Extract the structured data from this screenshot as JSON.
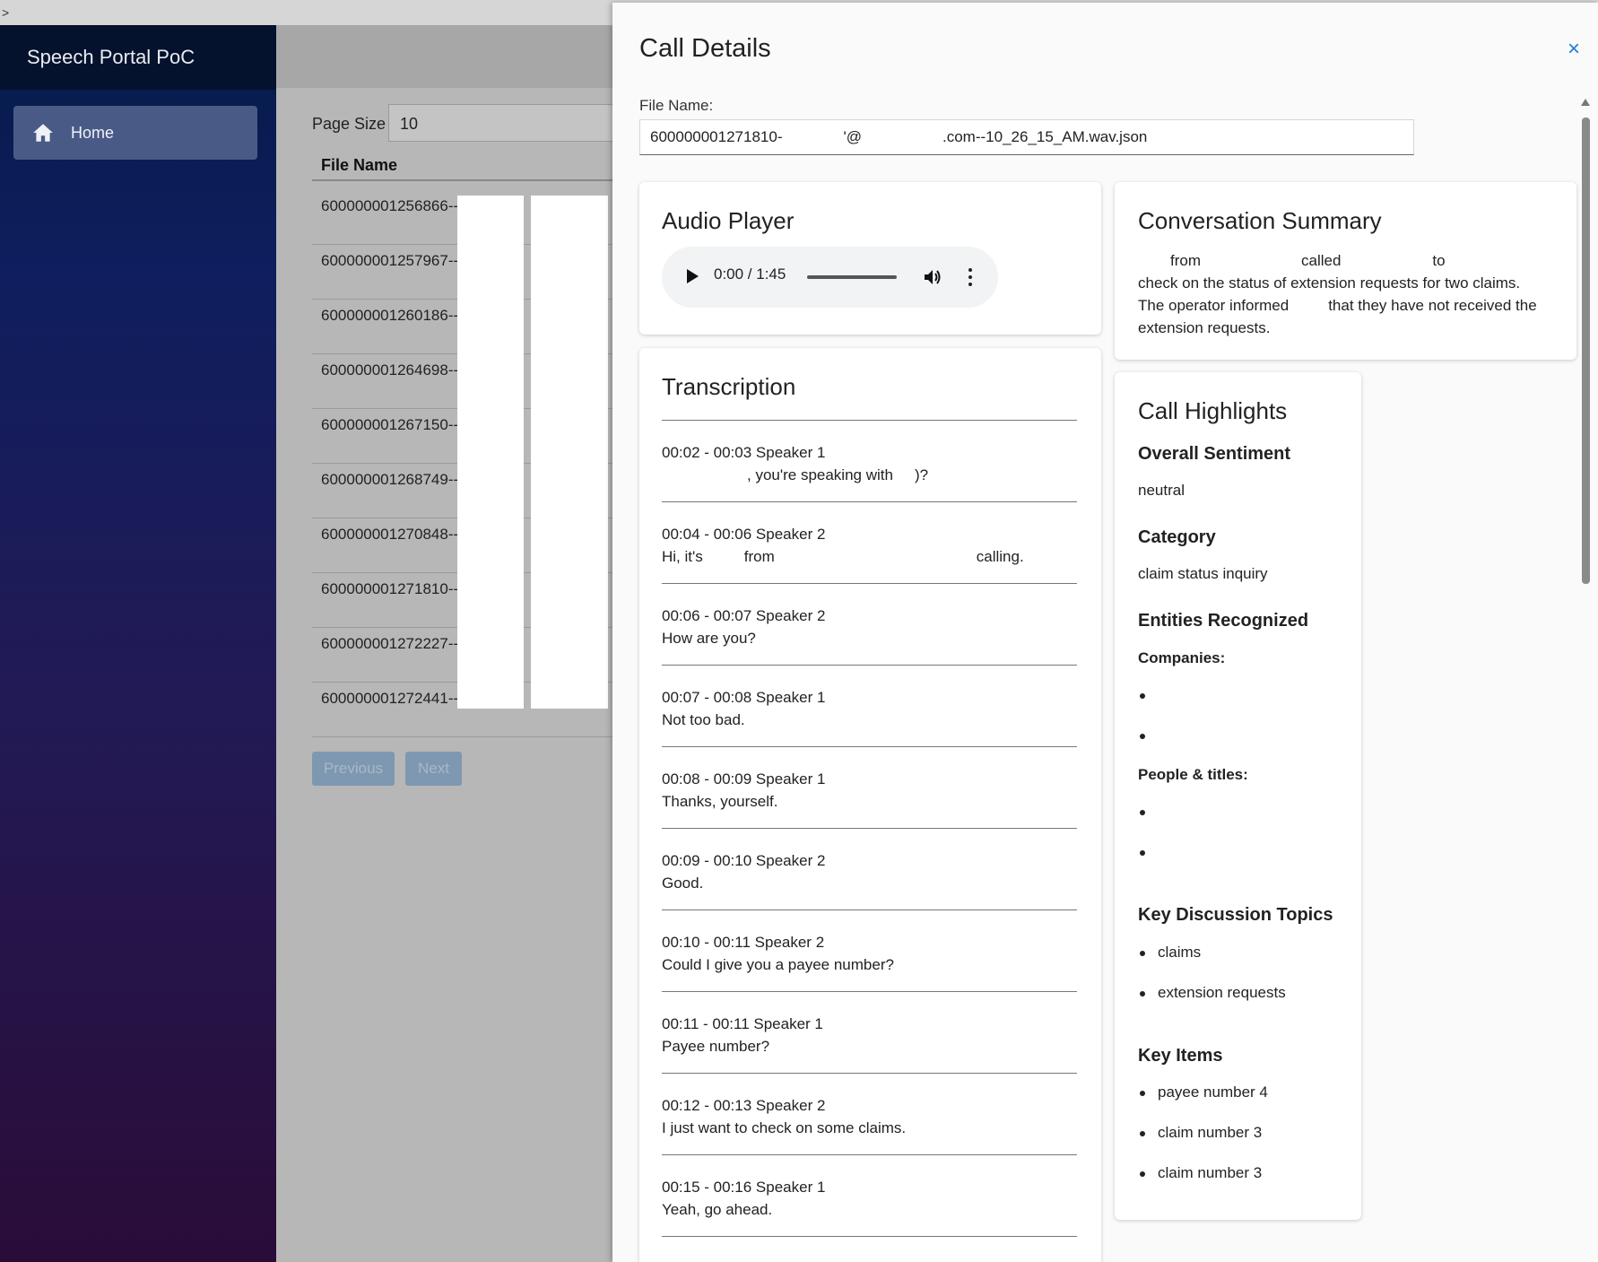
{
  "app": {
    "title": "Speech Portal PoC"
  },
  "sidebar": {
    "items": [
      {
        "label": "Home",
        "icon": "home-icon"
      }
    ]
  },
  "list": {
    "page_size_label": "Page Size",
    "page_size_value": "10",
    "column_header": "File Name",
    "rows": [
      "600000001256866--",
      "600000001257967--",
      "600000001260186--",
      "600000001264698--",
      "600000001267150--",
      "600000001268749--",
      "600000001270848--",
      "600000001271810--",
      "600000001272227--",
      "600000001272441--"
    ],
    "previous_label": "Previous",
    "next_label": "Next"
  },
  "drawer": {
    "title": "Call Details",
    "close_label": "×",
    "file_name_label": "File Name:",
    "file_name_part1": "600000001271810-",
    "file_name_part2": "'@",
    "file_name_part3": ".com--10_26_15_AM.wav.json"
  },
  "audio": {
    "title": "Audio Player",
    "time": "0:00 / 1:45"
  },
  "transcription": {
    "title": "Transcription",
    "segments": [
      {
        "meta": "00:02 - 00:03 Speaker 1",
        "text": ", you're speaking with",
        "tail": ")?"
      },
      {
        "meta": "00:04 - 00:06 Speaker 2",
        "text": "Hi, it's",
        "mid": "from",
        "tail": "calling."
      },
      {
        "meta": "00:06 - 00:07 Speaker 2",
        "text": "How are you?"
      },
      {
        "meta": "00:07 - 00:08 Speaker 1",
        "text": "Not too bad."
      },
      {
        "meta": "00:08 - 00:09 Speaker 1",
        "text": "Thanks, yourself."
      },
      {
        "meta": "00:09 - 00:10 Speaker 2",
        "text": "Good."
      },
      {
        "meta": "00:10 - 00:11 Speaker 2",
        "text": "Could I give you a payee number?"
      },
      {
        "meta": "00:11 - 00:11 Speaker 1",
        "text": "Payee number?"
      },
      {
        "meta": "00:12 - 00:13 Speaker 2",
        "text": "I just want to check on some claims."
      },
      {
        "meta": "00:15 - 00:16 Speaker 1",
        "text": "Yeah, go ahead."
      }
    ]
  },
  "summary": {
    "title": "Conversation Summary",
    "w1": "from",
    "w2": "called",
    "w3": "to",
    "line2": "check on the status of extension requests for two claims.",
    "line3a": "The operator informed",
    "line3b": "that they have not received the",
    "line4": "extension requests."
  },
  "highlights": {
    "title": "Call Highlights",
    "sentiment_label": "Overall Sentiment",
    "sentiment": "neutral",
    "category_label": "Category",
    "category": "claim status inquiry",
    "entities_label": "Entities Recognized",
    "companies_label": "Companies:",
    "people_label": "People & titles:",
    "topics_label": "Key Discussion Topics",
    "topics": [
      "claims",
      "extension requests"
    ],
    "items_label": "Key Items",
    "items": [
      "payee number 4",
      "claim number 3",
      "claim number 3"
    ]
  }
}
